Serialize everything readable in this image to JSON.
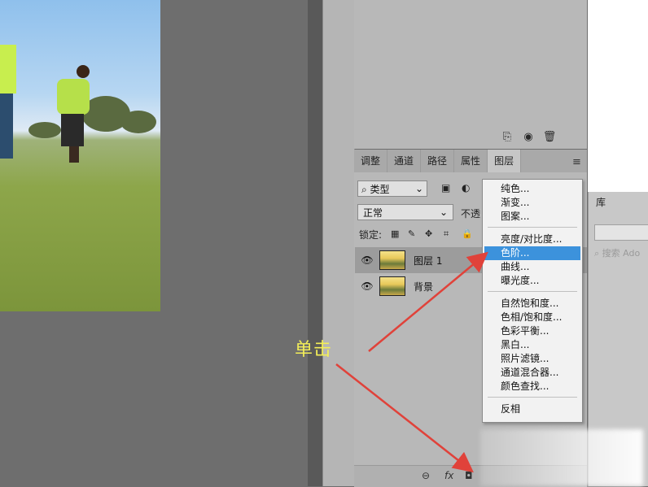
{
  "tabs": [
    "调整",
    "通道",
    "路径",
    "属性",
    "图层"
  ],
  "active_tab": "图层",
  "filter": {
    "label": "类型"
  },
  "blend": {
    "mode": "正常",
    "opacity_label": "不透"
  },
  "lock_label": "锁定:",
  "layers": [
    {
      "name": "图层 1",
      "selected": true
    },
    {
      "name": "背景",
      "selected": false
    }
  ],
  "library": {
    "tab": "库",
    "search_placeholder": "搜索 Ado"
  },
  "menu": {
    "groups": [
      [
        "纯色...",
        "渐变...",
        "图案..."
      ],
      [
        "亮度/对比度...",
        "色阶...",
        "曲线...",
        "曝光度..."
      ],
      [
        "自然饱和度...",
        "色相/饱和度...",
        "色彩平衡...",
        "黑白...",
        "照片滤镜...",
        "通道混合器...",
        "颜色查找..."
      ],
      [
        "反相"
      ]
    ],
    "highlighted": "色阶..."
  },
  "annotation": "单击",
  "colors": {
    "highlight": "#3c92dc",
    "annotation": "#f4ef58",
    "arrow": "#e0423a"
  }
}
